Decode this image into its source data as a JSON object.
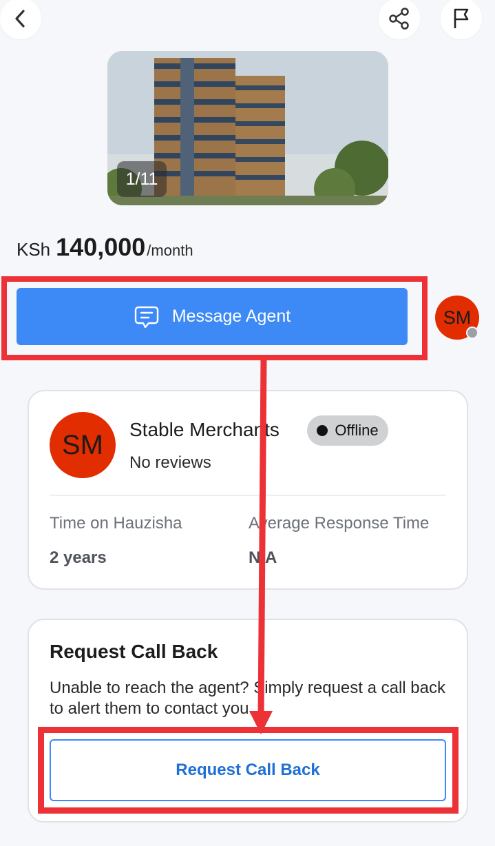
{
  "header": {
    "back_icon": "chevron-left-icon",
    "share_icon": "share-icon",
    "flag_icon": "flag-icon"
  },
  "gallery": {
    "counter": "1/11"
  },
  "listing": {
    "currency": "KSh",
    "amount": "140,000",
    "period": "/month"
  },
  "actions": {
    "message_label": "Message Agent",
    "message_icon": "chat-icon"
  },
  "agent": {
    "initials": "SM",
    "name": "Stable Merchants",
    "status": "Offline",
    "reviews": "No reviews",
    "time_label": "Time on Hauzisha",
    "time_value": "2 years",
    "response_label": "Average Response Time",
    "response_value": "N/A",
    "avatar_color": "#e12d00"
  },
  "callback": {
    "title": "Request Call Back",
    "description": "Unable to reach the agent? Simply request a call back to alert them to contact you.",
    "button_label": "Request Call Back"
  },
  "colors": {
    "accent": "#3d8af7",
    "highlight": "#ec3237"
  }
}
